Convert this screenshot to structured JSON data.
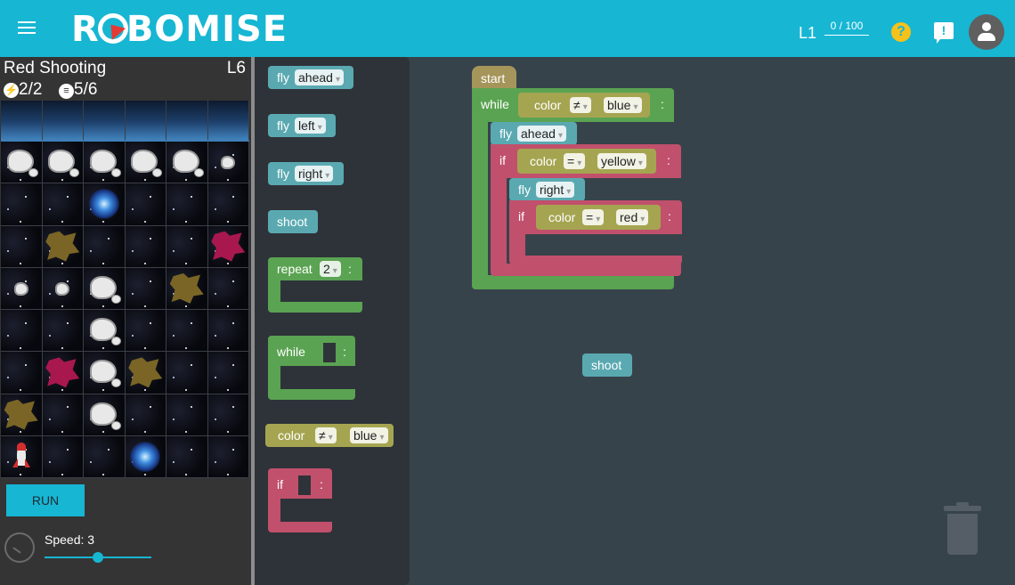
{
  "header": {
    "logo": "ROBOMISE",
    "level": "L1",
    "score": "0 / 100",
    "help_icon": "?",
    "feedback_icon": "!"
  },
  "level": {
    "title": "Red Shooting",
    "code": "L6",
    "energy": "2/2",
    "blocks": "5/6"
  },
  "grid": [
    [
      "planet",
      "planet",
      "planet",
      "planet",
      "planet",
      "planet"
    ],
    [
      "asteroid",
      "asteroid",
      "asteroid",
      "asteroid",
      "asteroid",
      "asteroid-small"
    ],
    [
      "star",
      "star",
      "vortex",
      "star",
      "star",
      "star"
    ],
    [
      "star",
      "crystal-yellow",
      "star",
      "star",
      "star",
      "crystal-red"
    ],
    [
      "asteroid-small",
      "asteroid-small",
      "asteroid",
      "star",
      "crystal-yellow",
      "star"
    ],
    [
      "star",
      "star",
      "asteroid",
      "star",
      "star",
      "star"
    ],
    [
      "star",
      "crystal-red",
      "asteroid",
      "crystal-yellow",
      "star",
      "star"
    ],
    [
      "crystal-yellow",
      "star",
      "asteroid",
      "star",
      "star",
      "star"
    ],
    [
      "ship",
      "star",
      "star",
      "vortex",
      "star",
      "star"
    ]
  ],
  "controls": {
    "run_label": "RUN",
    "speed_label": "Speed: 3",
    "speed_value": 3
  },
  "toolbox": {
    "fly_word": "fly",
    "ahead": "ahead",
    "left": "left",
    "right": "right",
    "shoot": "shoot",
    "repeat": "repeat",
    "repeat_count": "2",
    "colon": ":",
    "while": "while",
    "color": "color",
    "neq": "≠",
    "blue": "blue",
    "if": "if",
    "arrow": "▾"
  },
  "program": {
    "start": "start",
    "while": "while",
    "color": "color",
    "neq": "≠",
    "eq": "=",
    "blue": "blue",
    "fly": "fly",
    "ahead": "ahead",
    "if": "if",
    "yellow": "yellow",
    "right": "right",
    "red": "red",
    "colon": ":",
    "shoot": "shoot",
    "arrow": "▾"
  },
  "colors": {
    "accent": "#17b6d3",
    "fly": "#5aa9b1",
    "loop": "#5aa352",
    "condition": "#a5a551",
    "if": "#c1506c",
    "start": "#a5955a"
  }
}
